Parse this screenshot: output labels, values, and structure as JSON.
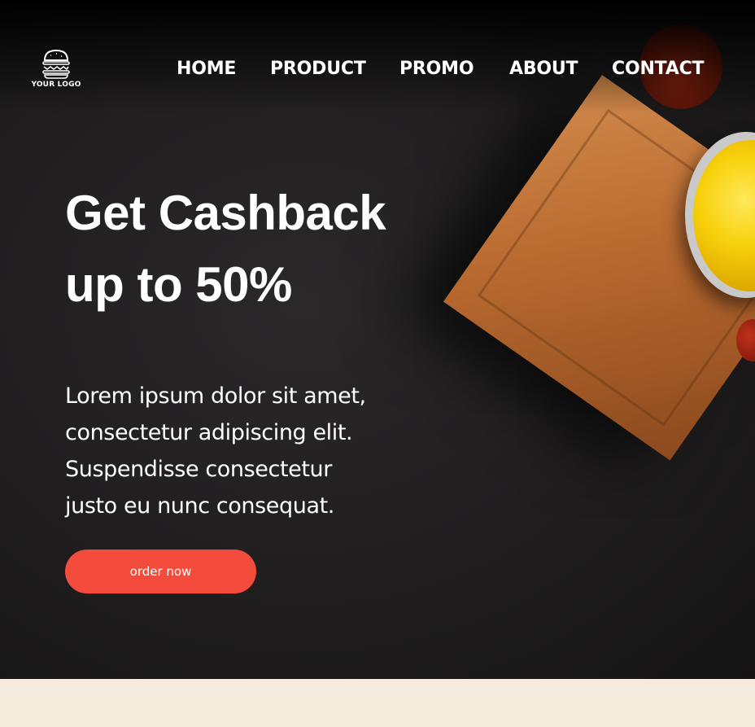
{
  "logo": {
    "icon": "burger-icon",
    "text": "YOUR LOGO"
  },
  "nav": [
    "HOME",
    "PRODUCT",
    "PROMO",
    "ABOUT",
    "CONTACT"
  ],
  "hero": {
    "headline": [
      "Get Cashback",
      "up to 50%"
    ],
    "description": [
      "Lorem ipsum dolor sit amet,",
      "consectetur adipiscing elit.",
      "Suspendisse consectetur",
      "justo eu nunc consequat."
    ],
    "cta_label": "order now"
  },
  "colors": {
    "accent": "#f44c3c",
    "hero_bg": "#1f1d1e",
    "section_bg": "#f5ecdd",
    "text": "#ffffff"
  }
}
